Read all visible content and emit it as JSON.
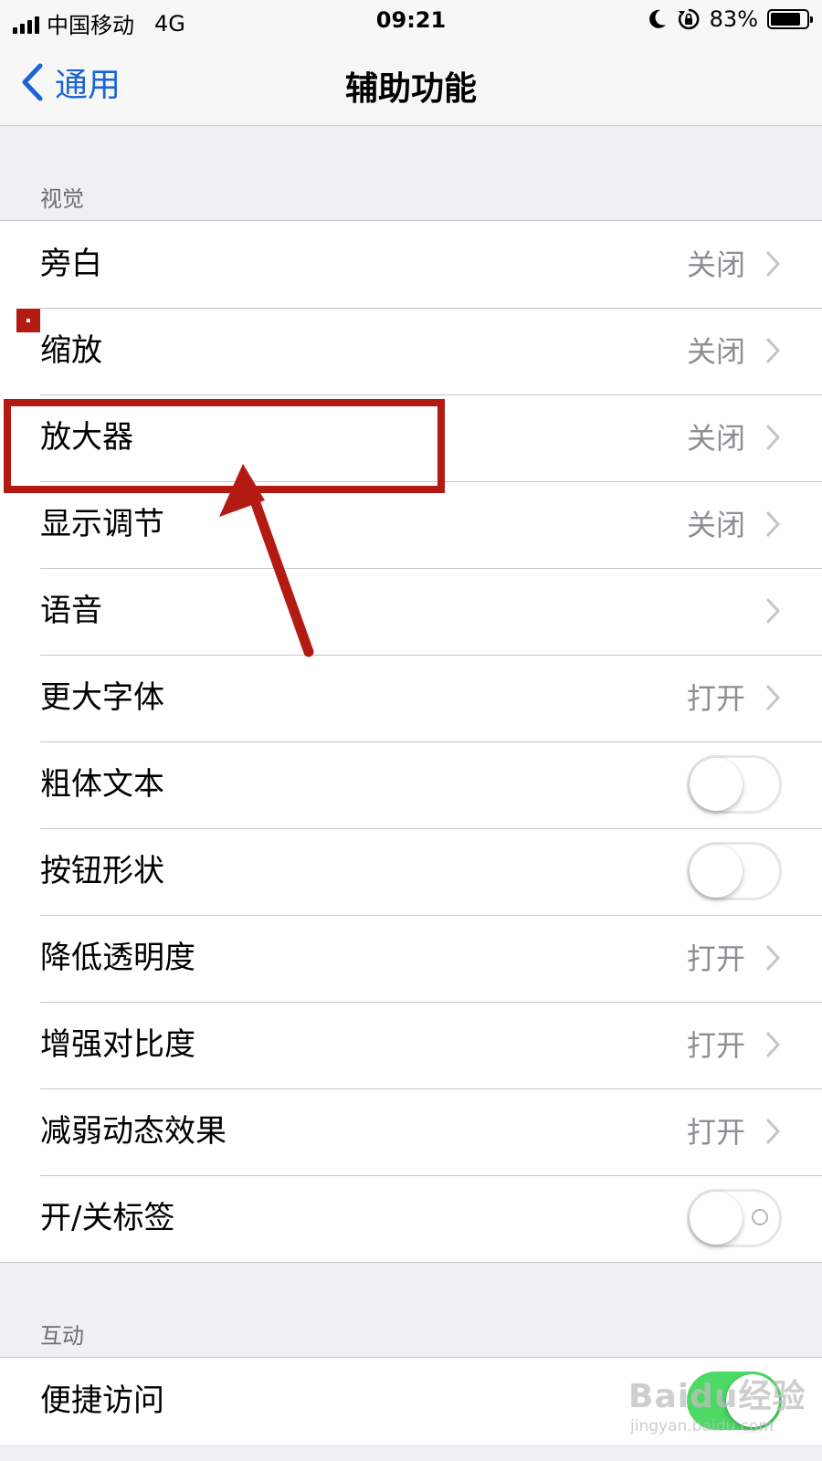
{
  "status_bar": {
    "carrier": "中国移动",
    "network": "4G",
    "time": "09:21",
    "battery_percent": "83%",
    "battery_level": 0.83
  },
  "navbar": {
    "back_label": "通用",
    "title": "辅助功能"
  },
  "sections": [
    {
      "header": "视觉",
      "rows": [
        {
          "label": "旁白",
          "value": "关闭",
          "type": "disclosure"
        },
        {
          "label": "缩放",
          "value": "关闭",
          "type": "disclosure"
        },
        {
          "label": "放大器",
          "value": "关闭",
          "type": "disclosure"
        },
        {
          "label": "显示调节",
          "value": "关闭",
          "type": "disclosure"
        },
        {
          "label": "语音",
          "value": "",
          "type": "disclosure"
        },
        {
          "label": "更大字体",
          "value": "打开",
          "type": "disclosure"
        },
        {
          "label": "粗体文本",
          "type": "toggle",
          "on": false
        },
        {
          "label": "按钮形状",
          "type": "toggle",
          "on": false
        },
        {
          "label": "降低透明度",
          "value": "打开",
          "type": "disclosure"
        },
        {
          "label": "增强对比度",
          "value": "打开",
          "type": "disclosure"
        },
        {
          "label": "减弱动态效果",
          "value": "打开",
          "type": "disclosure"
        },
        {
          "label": "开/关标签",
          "type": "toggle",
          "on": false
        }
      ]
    },
    {
      "header": "互动",
      "rows": [
        {
          "label": "便捷访问",
          "type": "toggle",
          "on": true
        }
      ]
    }
  ],
  "watermark": {
    "text": "Baidu经验",
    "sub": "jingyan.baidu.com"
  },
  "colors": {
    "accent": "#1a64d6",
    "annotation": "#b31b12",
    "toggle_on": "#4cd964"
  }
}
